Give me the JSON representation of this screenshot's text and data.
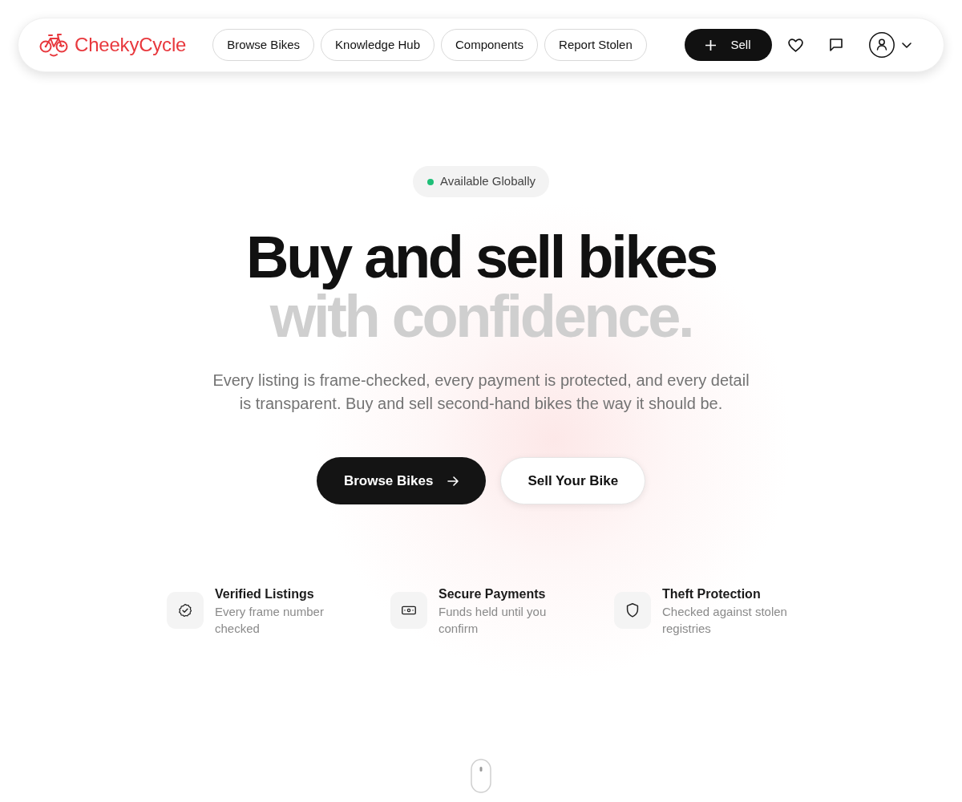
{
  "navbar": {
    "brand": "CheekyCycle",
    "links": [
      {
        "label": "Browse Bikes"
      },
      {
        "label": "Knowledge Hub"
      },
      {
        "label": "Components"
      },
      {
        "label": "Report Stolen"
      }
    ],
    "sell_button": {
      "label": "Sell"
    }
  },
  "hero": {
    "badge": "Available Globally",
    "headline": "Buy and sell bikes",
    "headline_accent": "with confidence.",
    "description": "Every listing is frame-checked, every payment is protected, and every detail is transparent. Buy and sell second-hand bikes the way it should be.",
    "buttons": [
      {
        "label": "Browse Bikes",
        "kind": "primary"
      },
      {
        "label": "Sell Your Bike",
        "kind": "secondary"
      }
    ]
  },
  "features": [
    {
      "kind": "verified",
      "title": "Verified Listings",
      "description": "Every frame number checked"
    },
    {
      "kind": "payment",
      "title": "Secure Payments",
      "description": "Funds held until you confirm"
    },
    {
      "kind": "theft",
      "title": "Theft Protection",
      "description": "Checked against stolen registries"
    }
  ]
}
